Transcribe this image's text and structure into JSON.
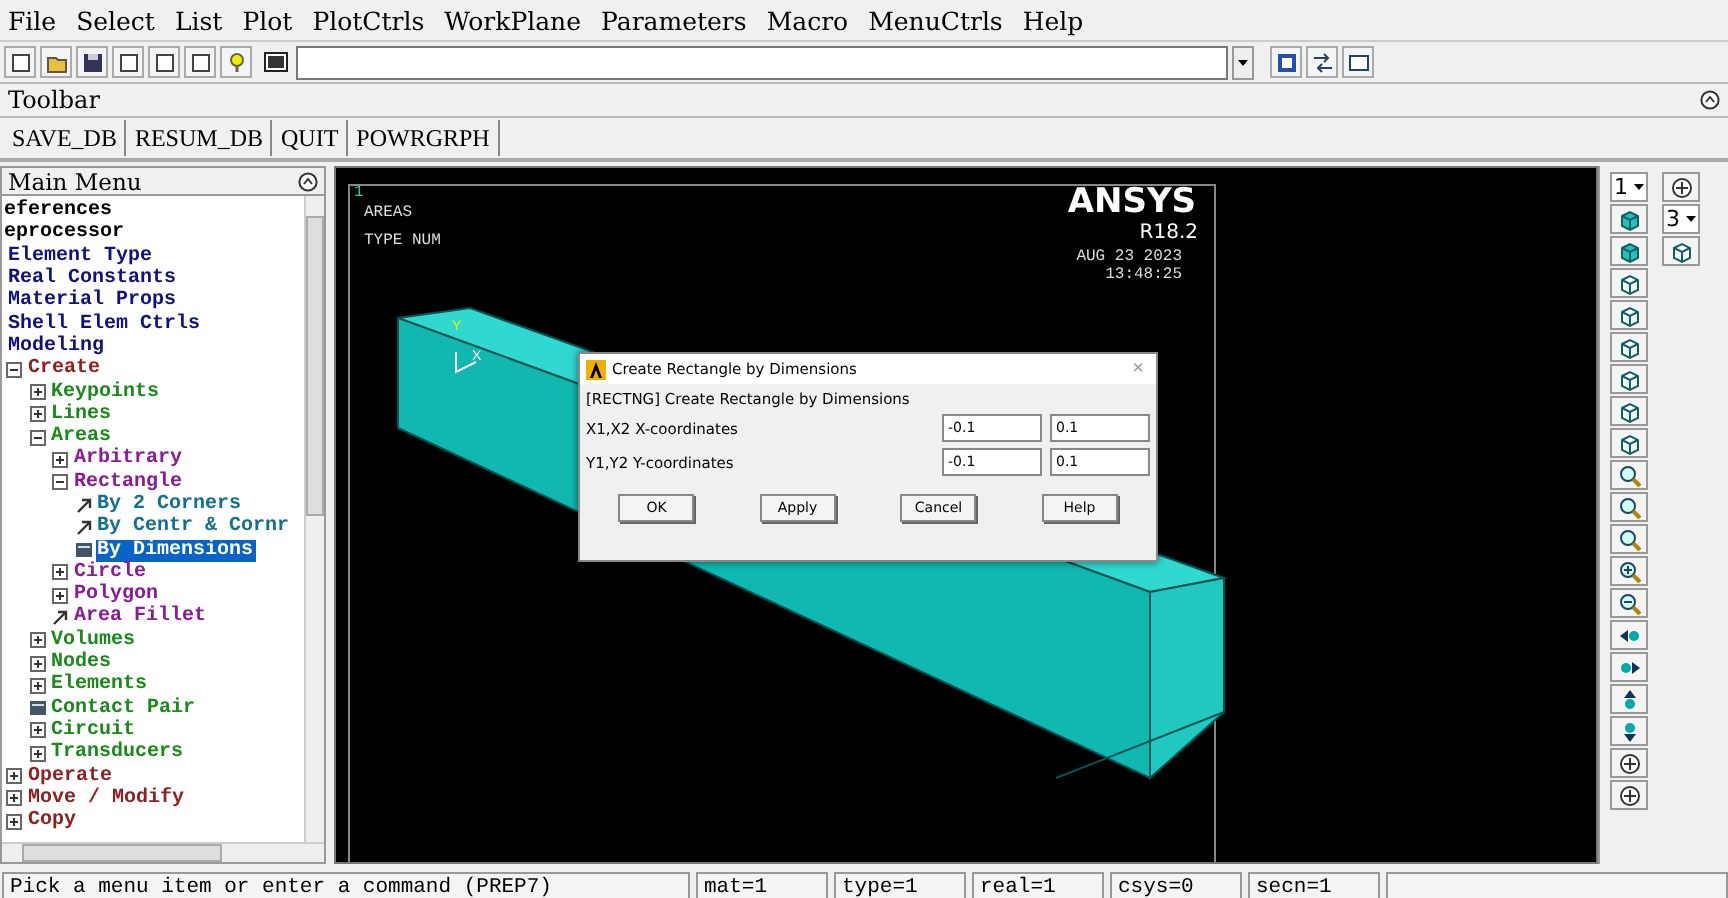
{
  "menu_bar": [
    "File",
    "Select",
    "List",
    "Plot",
    "PlotCtrls",
    "WorkPlane",
    "Parameters",
    "Macro",
    "MenuCtrls",
    "Help"
  ],
  "toolbar": {
    "title": "Toolbar",
    "buttons": [
      "SAVE_DB",
      "RESUM_DB",
      "QUIT",
      "POWRGRPH"
    ]
  },
  "main_menu": {
    "title": "Main Menu",
    "items": [
      {
        "label": "eferences",
        "selected": false
      },
      {
        "label": "eprocessor",
        "selected": false,
        "children": [
          {
            "label": "Element Type",
            "selected": false
          },
          {
            "label": "Real Constants",
            "selected": false
          },
          {
            "label": "Material Props",
            "selected": false
          },
          {
            "label": "Shell Elem Ctrls",
            "selected": false
          },
          {
            "label": "Modeling",
            "selected": false,
            "children": [
              {
                "label": "Create",
                "kind": "folder",
                "expanded": true,
                "selected": false,
                "children": [
                  {
                    "label": "Keypoints",
                    "kind": "folder",
                    "expanded": false,
                    "selected": false
                  },
                  {
                    "label": "Lines",
                    "kind": "folder",
                    "expanded": false,
                    "selected": false
                  },
                  {
                    "label": "Areas",
                    "kind": "folder",
                    "expanded": true,
                    "selected": false,
                    "children": [
                      {
                        "label": "Arbitrary",
                        "kind": "folder",
                        "expanded": false,
                        "selected": false
                      },
                      {
                        "label": "Rectangle",
                        "kind": "folder",
                        "expanded": true,
                        "selected": false,
                        "children": [
                          {
                            "label": "By 2 Corners",
                            "kind": "pick",
                            "selected": false
                          },
                          {
                            "label": "By Centr & Cornr",
                            "kind": "pick",
                            "selected": false
                          },
                          {
                            "label": "By Dimensions",
                            "kind": "dialog",
                            "selected": true
                          }
                        ]
                      },
                      {
                        "label": "Circle",
                        "kind": "folder",
                        "expanded": false,
                        "selected": false
                      },
                      {
                        "label": "Polygon",
                        "kind": "folder",
                        "expanded": false,
                        "selected": false
                      },
                      {
                        "label": "Area Fillet",
                        "kind": "pick",
                        "selected": false
                      }
                    ]
                  },
                  {
                    "label": "Volumes",
                    "kind": "folder",
                    "expanded": false,
                    "selected": false
                  },
                  {
                    "label": "Nodes",
                    "kind": "folder",
                    "expanded": false,
                    "selected": false
                  },
                  {
                    "label": "Elements",
                    "kind": "folder",
                    "expanded": false,
                    "selected": false
                  },
                  {
                    "label": "Contact Pair",
                    "kind": "dialog",
                    "selected": false
                  },
                  {
                    "label": "Circuit",
                    "kind": "folder",
                    "expanded": false,
                    "selected": false
                  },
                  {
                    "label": "Transducers",
                    "kind": "folder",
                    "expanded": false,
                    "selected": false
                  }
                ]
              },
              {
                "label": "Operate",
                "kind": "folder",
                "expanded": false,
                "selected": false
              },
              {
                "label": "Move / Modify",
                "kind": "folder",
                "expanded": false,
                "selected": false
              },
              {
                "label": "Copy",
                "kind": "folder",
                "expanded": false,
                "selected": false
              }
            ]
          }
        ]
      }
    ]
  },
  "graphics": {
    "window_number": "1",
    "labels": [
      "AREAS",
      "TYPE NUM"
    ],
    "product": "ANSYS",
    "release": "R18.2",
    "date": "AUG 23 2023",
    "time": "13:48:25",
    "triad": [
      "Y",
      "X"
    ]
  },
  "dialog": {
    "title": "Create Rectangle by Dimensions",
    "close": "×",
    "heading": "[RECTNG]  Create Rectangle by Dimensions",
    "rows": [
      {
        "label": "X1,X2  X-coordinates",
        "values": [
          "-0.1",
          "0.1"
        ]
      },
      {
        "label": "Y1,Y2  Y-coordinates",
        "values": [
          "-0.1",
          "0.1"
        ]
      }
    ],
    "buttons": [
      "OK",
      "Apply",
      "Cancel",
      "Help"
    ]
  },
  "view_toolbar": {
    "window_select": "1",
    "view_select": "3"
  },
  "status_bar": [
    "Pick a menu item or enter a command (PREP7)",
    "mat=1",
    "type=1",
    "real=1",
    "csys=0",
    "secn=1"
  ]
}
